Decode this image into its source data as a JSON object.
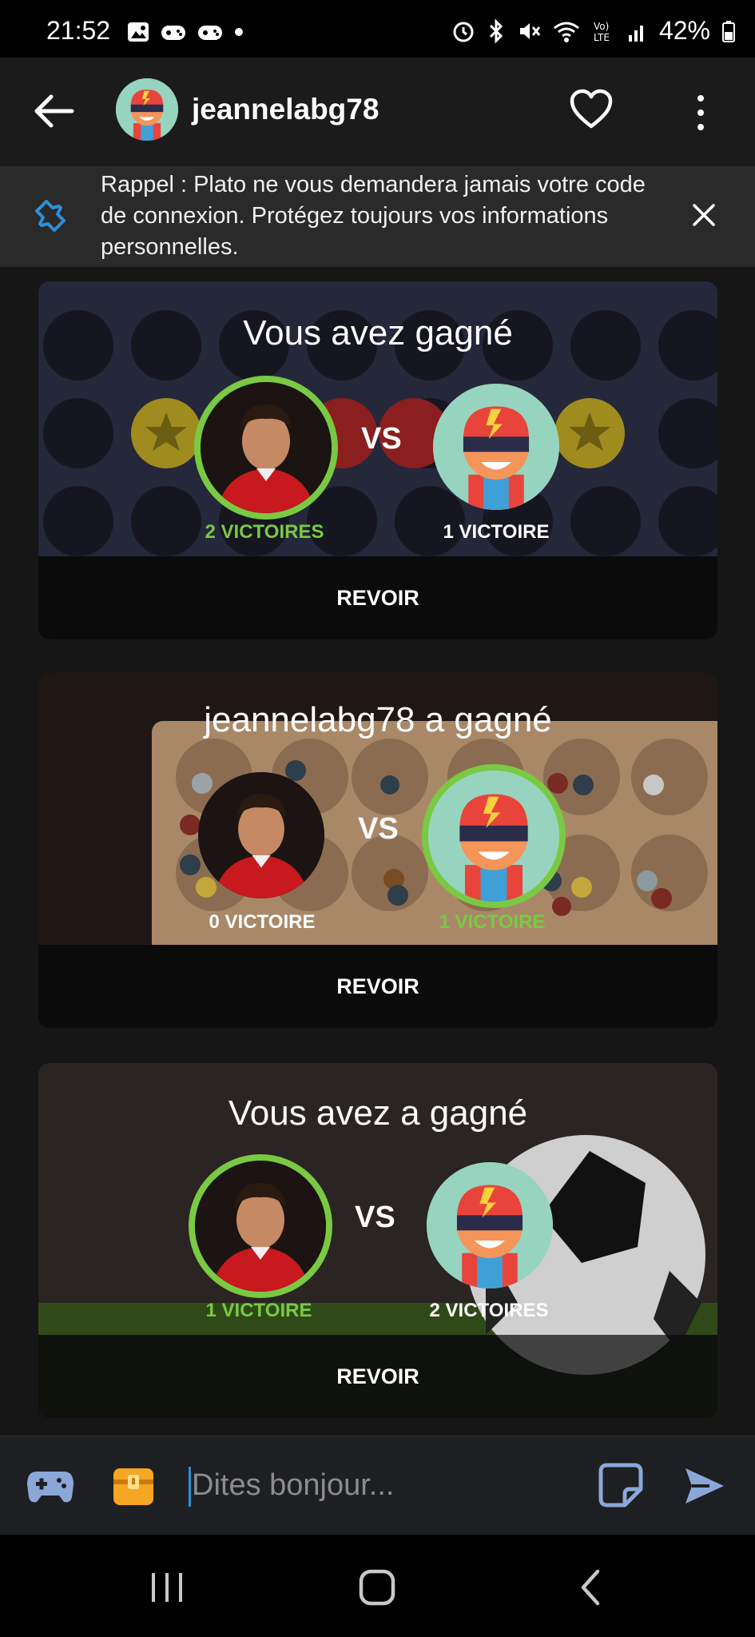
{
  "status_bar": {
    "time": "21:52",
    "battery": "42%"
  },
  "header": {
    "username": "jeannelabg78"
  },
  "notice": {
    "text": "Rappel : Plato ne vous demandera jamais votre code de connexion. Protégez toujours vos informations personnelles."
  },
  "cards": [
    {
      "title": "Vous avez gagné",
      "left_label": "2 VICTOIRES",
      "right_label": "1 VICTOIRE",
      "vs": "VS",
      "replay": "REVOIR"
    },
    {
      "title": "jeannelabg78 a gagné",
      "left_label": "0 VICTOIRE",
      "right_label": "1 VICTOIRE",
      "vs": "VS",
      "replay": "REVOIR"
    },
    {
      "title": "Vous avez a gagné",
      "left_label": "1 VICTOIRE",
      "right_label": "2 VICTOIRES",
      "vs": "VS",
      "replay": "REVOIR"
    }
  ],
  "composer": {
    "placeholder": "Dites bonjour..."
  },
  "colors": {
    "winner_green": "#7ac943",
    "accent_blue": "#2e8fd6"
  }
}
